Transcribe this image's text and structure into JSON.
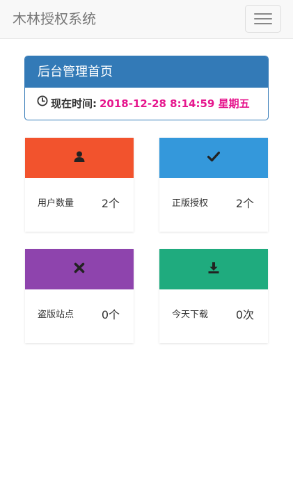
{
  "navbar": {
    "brand": "木林授权系统",
    "menu_icon": "hamburger-icon"
  },
  "panel": {
    "title": "后台管理首页",
    "time_label": "现在时间:",
    "time_value": "2018-12-28 8:14:59 星期五",
    "time_icon": "clock-icon"
  },
  "stats": [
    {
      "label": "用户数量",
      "value": "2个",
      "icon": "user-icon",
      "color": "#f2532d"
    },
    {
      "label": "正版授权",
      "value": "2个",
      "icon": "check-icon",
      "color": "#3498db"
    },
    {
      "label": "盗版站点",
      "value": "0个",
      "icon": "close-icon",
      "color": "#8e44ad"
    },
    {
      "label": "今天下载",
      "value": "0次",
      "icon": "download-icon",
      "color": "#1fab7e"
    }
  ],
  "colors": {
    "primary": "#337ab7",
    "time_text": "#e6168d"
  }
}
